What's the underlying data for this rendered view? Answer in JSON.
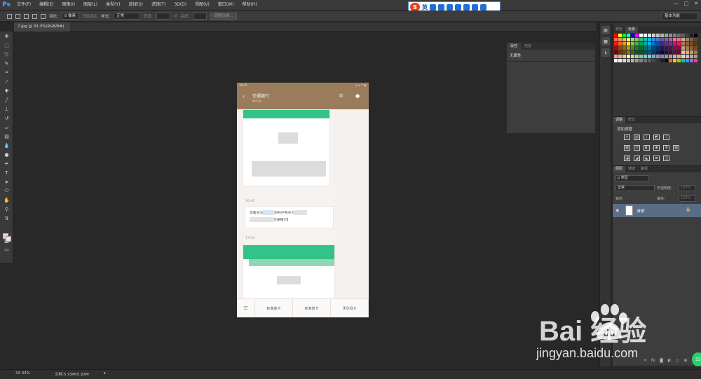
{
  "app": {
    "logo": "Ps"
  },
  "menu": [
    "文件(F)",
    "编辑(E)",
    "图像(I)",
    "图层(L)",
    "类型(Y)",
    "选择(S)",
    "滤镜(T)",
    "3D(D)",
    "视图(V)",
    "窗口(W)",
    "帮助(H)"
  ],
  "window_controls": [
    "—",
    "□",
    "✕"
  ],
  "ime": {
    "logo": "S",
    "lang": "英"
  },
  "options": {
    "feather_label": "羽化:",
    "feather_value": "0 像素",
    "antialias": "消除锯齿",
    "style_label": "样式:",
    "style_value": "正常",
    "width_label": "宽度:",
    "height_label": "高度:",
    "refine_edge": "调整边缘...",
    "workspace": "基本功能"
  },
  "doc_tab": {
    "label": "7.jpg @ 33.3%(RGB/8#)",
    "close": "×"
  },
  "phone": {
    "status_time": "16:35",
    "status_right": "◷ ▾ ⁴ᴳ ▮",
    "back": "‹",
    "title": "交通银行",
    "subtitle": "95559",
    "call_icon": "✆",
    "user_icon": "●",
    "ts1": "16:46",
    "msg_prefix": "您尾号为",
    "msg_mid": "的开户网点为",
    "msg_end": "交通银行】",
    "ts2": "17:05",
    "menu_icon": "☰",
    "tabs": [
      "标准金卡",
      "标准普卡",
      "沃尔玛卡"
    ]
  },
  "properties": {
    "tabs": [
      "属性",
      "信息"
    ],
    "body": "无属性"
  },
  "swatches": {
    "tabs": [
      "颜色",
      "色板"
    ]
  },
  "adjustments": {
    "tabs": [
      "调整",
      "样式"
    ],
    "title": "添加调整"
  },
  "layers": {
    "tabs": [
      "图层",
      "通道",
      "路径"
    ],
    "kind": "ρ 类型",
    "blend": "正常",
    "opacity_label": "不透明度:",
    "opacity_value": "100%",
    "lock_label": "锁定:",
    "fill_label": "填充:",
    "fill_value": "100%",
    "layer_name": "背景",
    "lock_icon": "🔒",
    "eye_icon": "👁"
  },
  "status": {
    "zoom": "33.33%",
    "docsize": "文档:5.93M/5.93M",
    "arrow": "▸"
  },
  "watermark": {
    "main": "Bai  经验",
    "url": "jingyan.baidu.com",
    "paw_text": "du"
  },
  "ext_badge": "55"
}
